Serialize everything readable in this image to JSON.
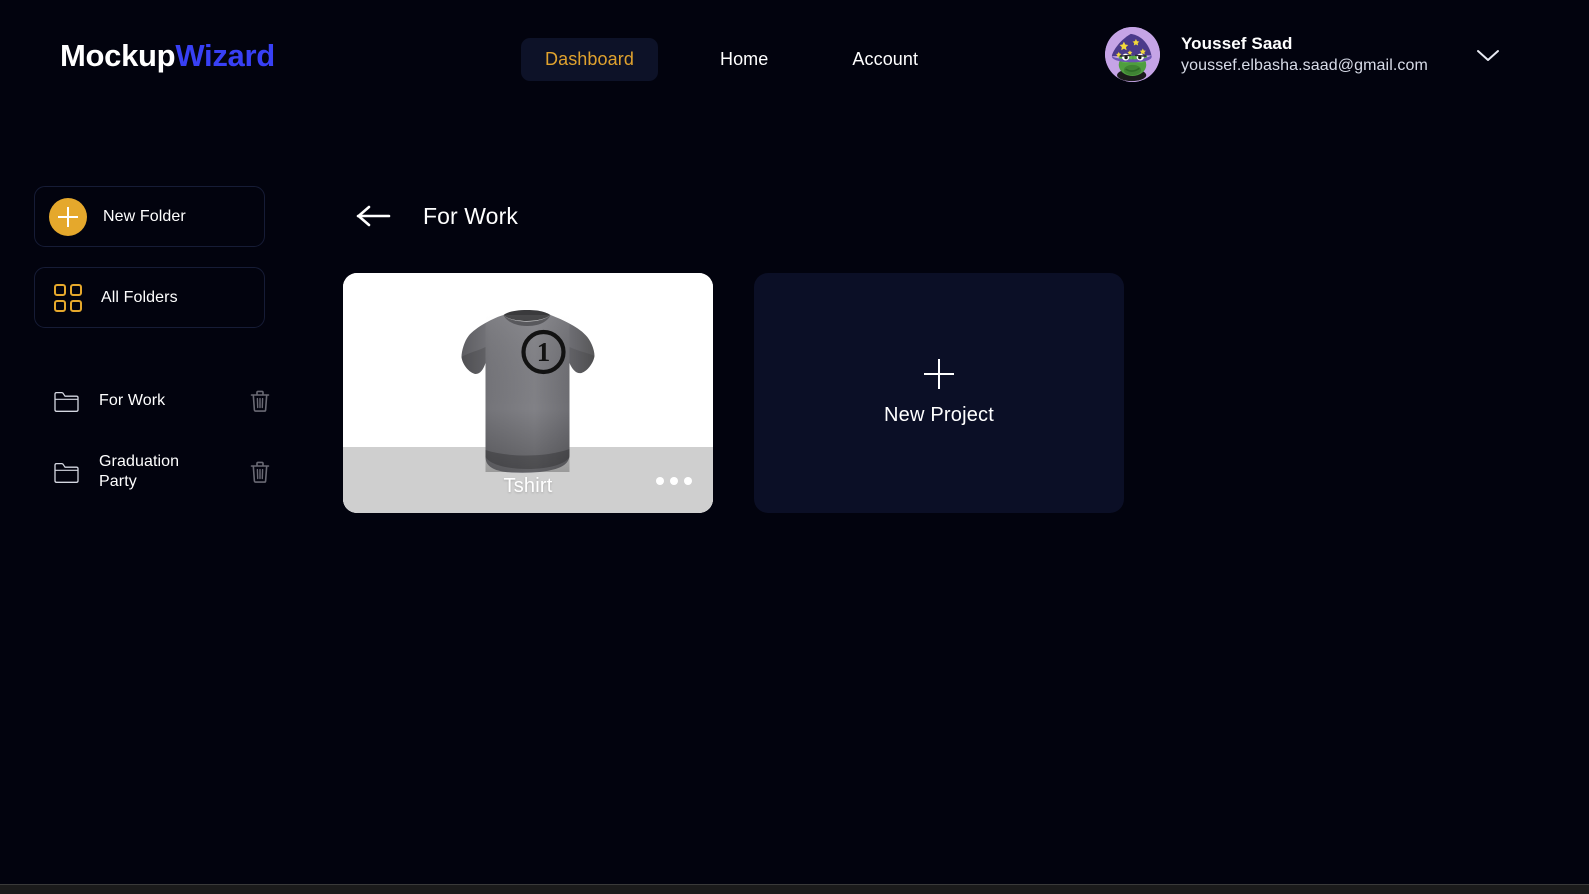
{
  "header": {
    "logo_part_1": "Mockup",
    "logo_part_2": "Wizard",
    "nav": [
      {
        "label": "Dashboard",
        "active": true
      },
      {
        "label": "Home",
        "active": false
      },
      {
        "label": "Account",
        "active": false
      }
    ],
    "profile": {
      "name": "Youssef Saad",
      "email": "youssef.elbasha.saad@gmail.com",
      "avatar_icon": "frog-wizard-avatar",
      "chevron_icon": "chevron-down-icon"
    }
  },
  "sidebar": {
    "new_folder": {
      "label": "New Folder",
      "icon": "plus-circle-icon"
    },
    "all_folders": {
      "label": "All Folders",
      "icon": "grid-icon"
    },
    "folders": [
      {
        "name": "For Work",
        "icon": "folder-icon",
        "delete_icon": "trash-icon"
      },
      {
        "name": "Graduation Party",
        "icon": "folder-icon",
        "delete_icon": "trash-icon"
      }
    ]
  },
  "main": {
    "back_icon": "arrow-left-icon",
    "title": "For Work",
    "projects": [
      {
        "name": "Tshirt",
        "mockup": "tshirt-mockup",
        "design_label": "1",
        "menu_icon": "more-options-icon"
      }
    ],
    "new_project": {
      "label": "New Project",
      "icon": "plus-icon"
    }
  },
  "colors": {
    "background": "#02030e",
    "accent_amber": "#e5a82c",
    "accent_blue": "#3840f5",
    "card_navy": "#0b0f26",
    "nav_pill": "#0d1228",
    "card_footer_gray": "#cfcfcf"
  }
}
